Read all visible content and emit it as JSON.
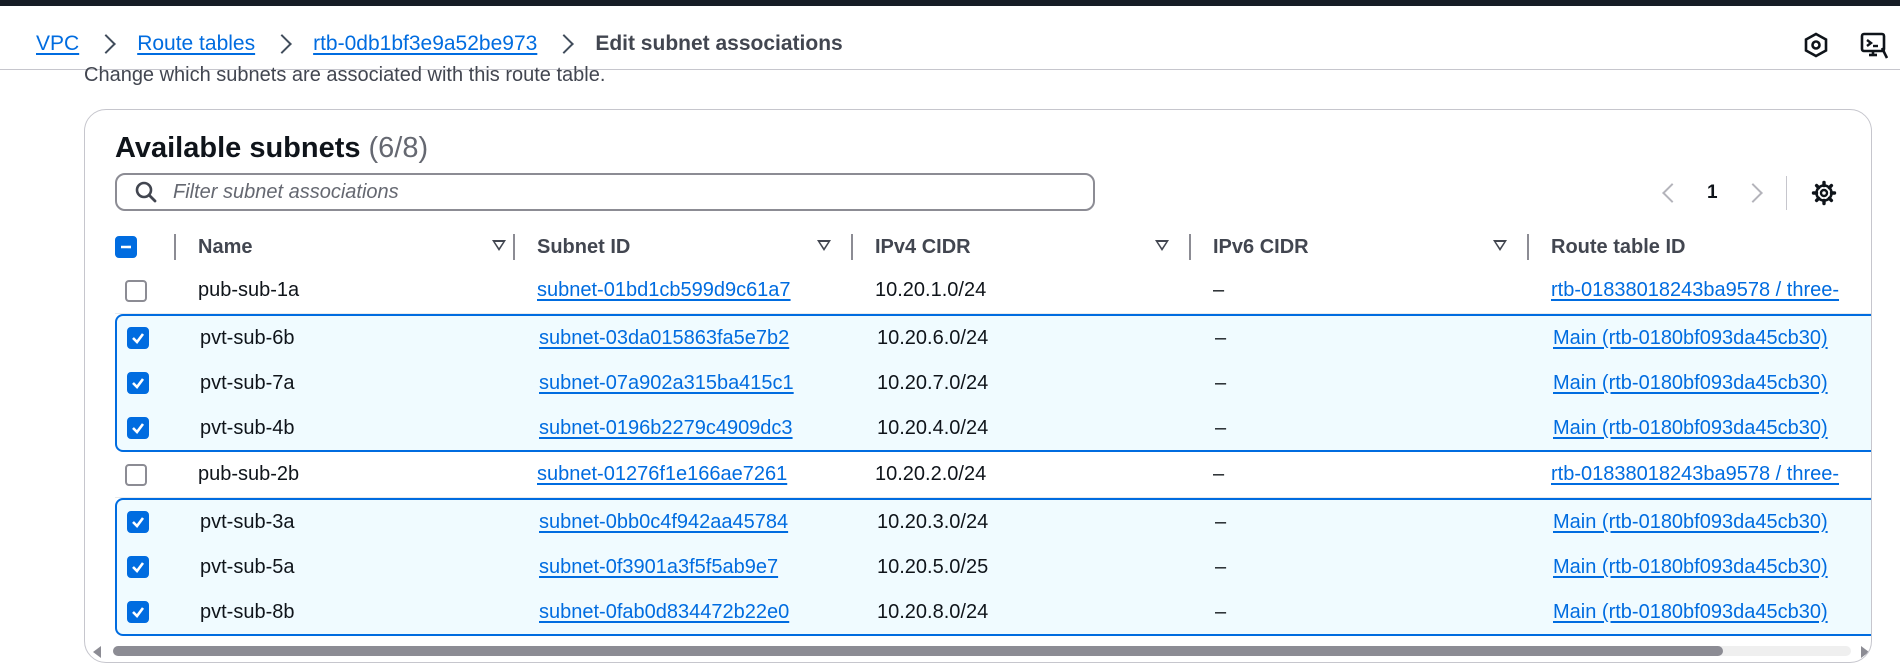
{
  "breadcrumbs": [
    {
      "label": "VPC"
    },
    {
      "label": "Route tables"
    },
    {
      "label": "rtb-0db1bf3e9a52be973"
    }
  ],
  "breadcrumb_current": "Edit subnet associations",
  "intro_text": "Change which subnets are associated with this route table.",
  "panel": {
    "title": "Available subnets",
    "count": "(6/8)",
    "filter_placeholder": "Filter subnet associations",
    "page_number": "1"
  },
  "columns": {
    "name": "Name",
    "subnet_id": "Subnet ID",
    "ipv4": "IPv4 CIDR",
    "ipv6": "IPv6 CIDR",
    "route_table": "Route table ID"
  },
  "rows": [
    {
      "name": "pub-sub-1a",
      "subnet_id": "subnet-01bd1cb599d9c61a7",
      "ipv4": "10.20.1.0/24",
      "ipv6": "–",
      "route_table": "rtb-01838018243ba9578 / three-",
      "selected": false
    },
    {
      "name": "pvt-sub-6b",
      "subnet_id": "subnet-03da015863fa5e7b2",
      "ipv4": "10.20.6.0/24",
      "ipv6": "–",
      "route_table": "Main (rtb-0180bf093da45cb30)",
      "selected": true
    },
    {
      "name": "pvt-sub-7a",
      "subnet_id": "subnet-07a902a315ba415c1",
      "ipv4": "10.20.7.0/24",
      "ipv6": "–",
      "route_table": "Main (rtb-0180bf093da45cb30)",
      "selected": true
    },
    {
      "name": "pvt-sub-4b",
      "subnet_id": "subnet-0196b2279c4909dc3",
      "ipv4": "10.20.4.0/24",
      "ipv6": "–",
      "route_table": "Main (rtb-0180bf093da45cb30)",
      "selected": true
    },
    {
      "name": "pub-sub-2b",
      "subnet_id": "subnet-01276f1e166ae7261",
      "ipv4": "10.20.2.0/24",
      "ipv6": "–",
      "route_table": "rtb-01838018243ba9578 / three-",
      "selected": false
    },
    {
      "name": "pvt-sub-3a",
      "subnet_id": "subnet-0bb0c4f942aa45784",
      "ipv4": "10.20.3.0/24",
      "ipv6": "–",
      "route_table": "Main (rtb-0180bf093da45cb30)",
      "selected": true
    },
    {
      "name": "pvt-sub-5a",
      "subnet_id": "subnet-0f3901a3f5f5ab9e7",
      "ipv4": "10.20.5.0/25",
      "ipv6": "–",
      "route_table": "Main (rtb-0180bf093da45cb30)",
      "selected": true
    },
    {
      "name": "pvt-sub-8b",
      "subnet_id": "subnet-0fab0d834472b22e0",
      "ipv4": "10.20.8.0/24",
      "ipv6": "–",
      "route_table": "Main (rtb-0180bf093da45cb30)",
      "selected": true
    }
  ],
  "icons": {
    "header_right_1": "hexagon-settings-icon",
    "header_right_2": "cloudshell-icon",
    "search": "search-icon",
    "settings": "gear-icon",
    "header_checkbox": "indeterminate-checkbox",
    "sort": "sort-caret-icon"
  },
  "colors": {
    "link": "#006ce0",
    "selected_bg": "#f0fbff",
    "selected_border": "#006ce0",
    "top_bar": "#161d26"
  }
}
